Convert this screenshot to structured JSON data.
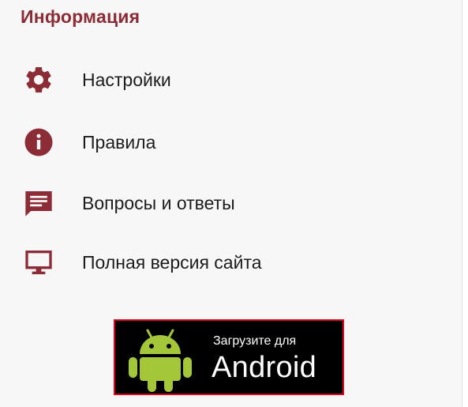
{
  "section": {
    "title": "Информация"
  },
  "menu": {
    "items": [
      {
        "label": "Настройки",
        "icon": "gear-icon"
      },
      {
        "label": "Правила",
        "icon": "info-icon"
      },
      {
        "label": "Вопросы и ответы",
        "icon": "chat-icon"
      },
      {
        "label": "Полная версия сайта",
        "icon": "monitor-icon"
      }
    ]
  },
  "android_badge": {
    "get_on": "Загрузите для",
    "platform": "Android",
    "icon": "android-robot-icon"
  },
  "colors": {
    "accent": "#8b2c36",
    "text": "#1c1c1c",
    "panel_background": "#f8f7f7",
    "badge_background": "#000000",
    "badge_border": "#e0001c",
    "android_green": "#a4c639"
  }
}
